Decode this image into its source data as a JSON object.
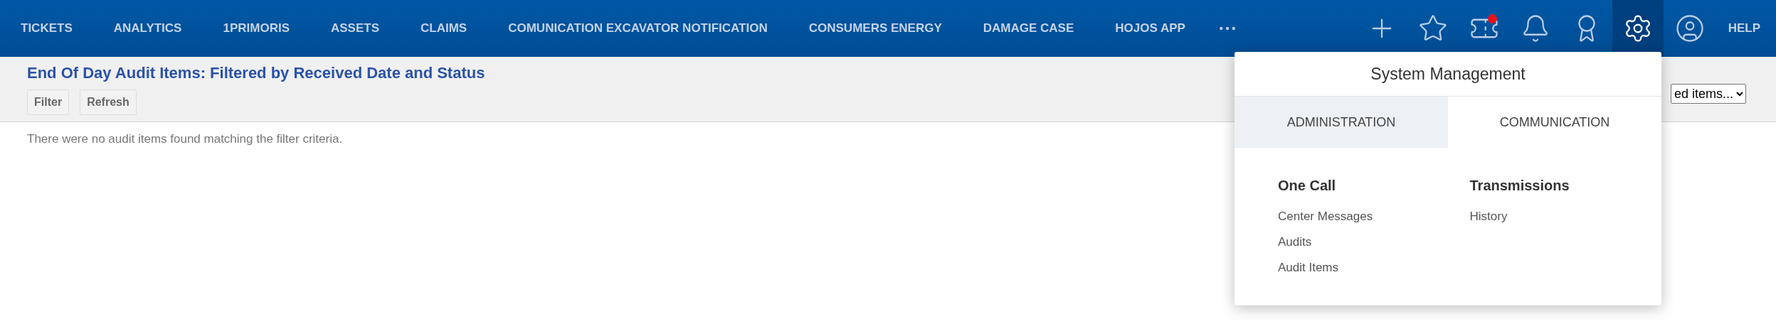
{
  "nav": {
    "items": [
      "TICKETS",
      "ANALYTICS",
      "1PRIMORIS",
      "ASSETS",
      "CLAIMS",
      "COMUNICATION EXCAVATOR NOTIFICATION",
      "CONSUMERS ENERGY",
      "DAMAGE CASE",
      "HOJOS APP"
    ],
    "icons": [
      {
        "kind": "more",
        "active": false,
        "badge": false
      },
      {
        "kind": "plus",
        "active": false,
        "badge": false
      },
      {
        "kind": "star",
        "active": false,
        "badge": false
      },
      {
        "kind": "ticket",
        "active": false,
        "badge": true
      },
      {
        "kind": "bell",
        "active": false,
        "badge": false
      },
      {
        "kind": "award",
        "active": false,
        "badge": false
      },
      {
        "kind": "gear",
        "active": true,
        "badge": false
      },
      {
        "kind": "user",
        "active": false,
        "badge": false
      }
    ],
    "help": "HELP"
  },
  "page": {
    "title": "End Of Day Audit Items: Filtered by Received Date and Status",
    "buttons": [
      "Filter",
      "Refresh"
    ],
    "select_value": "ed items...",
    "message": "There were no audit items found matching the filter criteria."
  },
  "menu": {
    "title": "System Management",
    "tabs": [
      {
        "label": "ADMINISTRATION",
        "selected": true
      },
      {
        "label": "COMMUNICATION",
        "selected": false
      }
    ],
    "columns": [
      {
        "heading": "One Call",
        "links": [
          "Center Messages",
          "Audits",
          "Audit Items"
        ]
      },
      {
        "heading": "Transmissions",
        "links": [
          "History"
        ]
      }
    ]
  }
}
